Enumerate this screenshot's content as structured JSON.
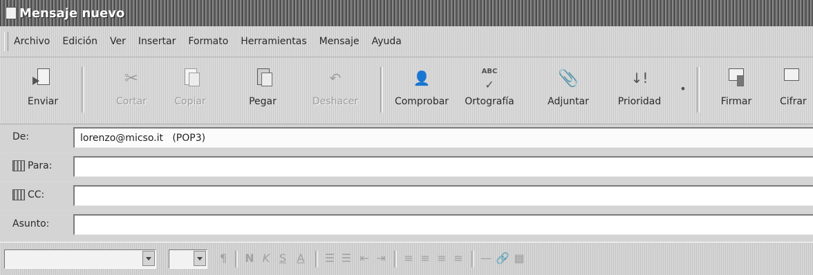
{
  "window": {
    "title": "Mensaje nuevo"
  },
  "menu": [
    "Archivo",
    "Edición",
    "Ver",
    "Insertar",
    "Formato",
    "Herramientas",
    "Mensaje",
    "Ayuda"
  ],
  "toolbar": {
    "send": "Enviar",
    "cut": "Cortar",
    "copy": "Copiar",
    "paste": "Pegar",
    "undo": "Deshacer",
    "check": "Comprobar",
    "spelling": "Ortografía",
    "attach": "Adjuntar",
    "priority": "Prioridad",
    "sign": "Firmar",
    "encrypt": "Cifrar"
  },
  "header": {
    "from_label": "De:",
    "from_value": "lorenzo@micso.it   (POP3)",
    "to_label": "Para:",
    "to_value": "",
    "cc_label": "CC:",
    "cc_value": "",
    "subject_label": "Asunto:",
    "subject_value": ""
  },
  "format": {
    "bold": "N",
    "italic": "K",
    "underline": "S",
    "color": "A"
  }
}
